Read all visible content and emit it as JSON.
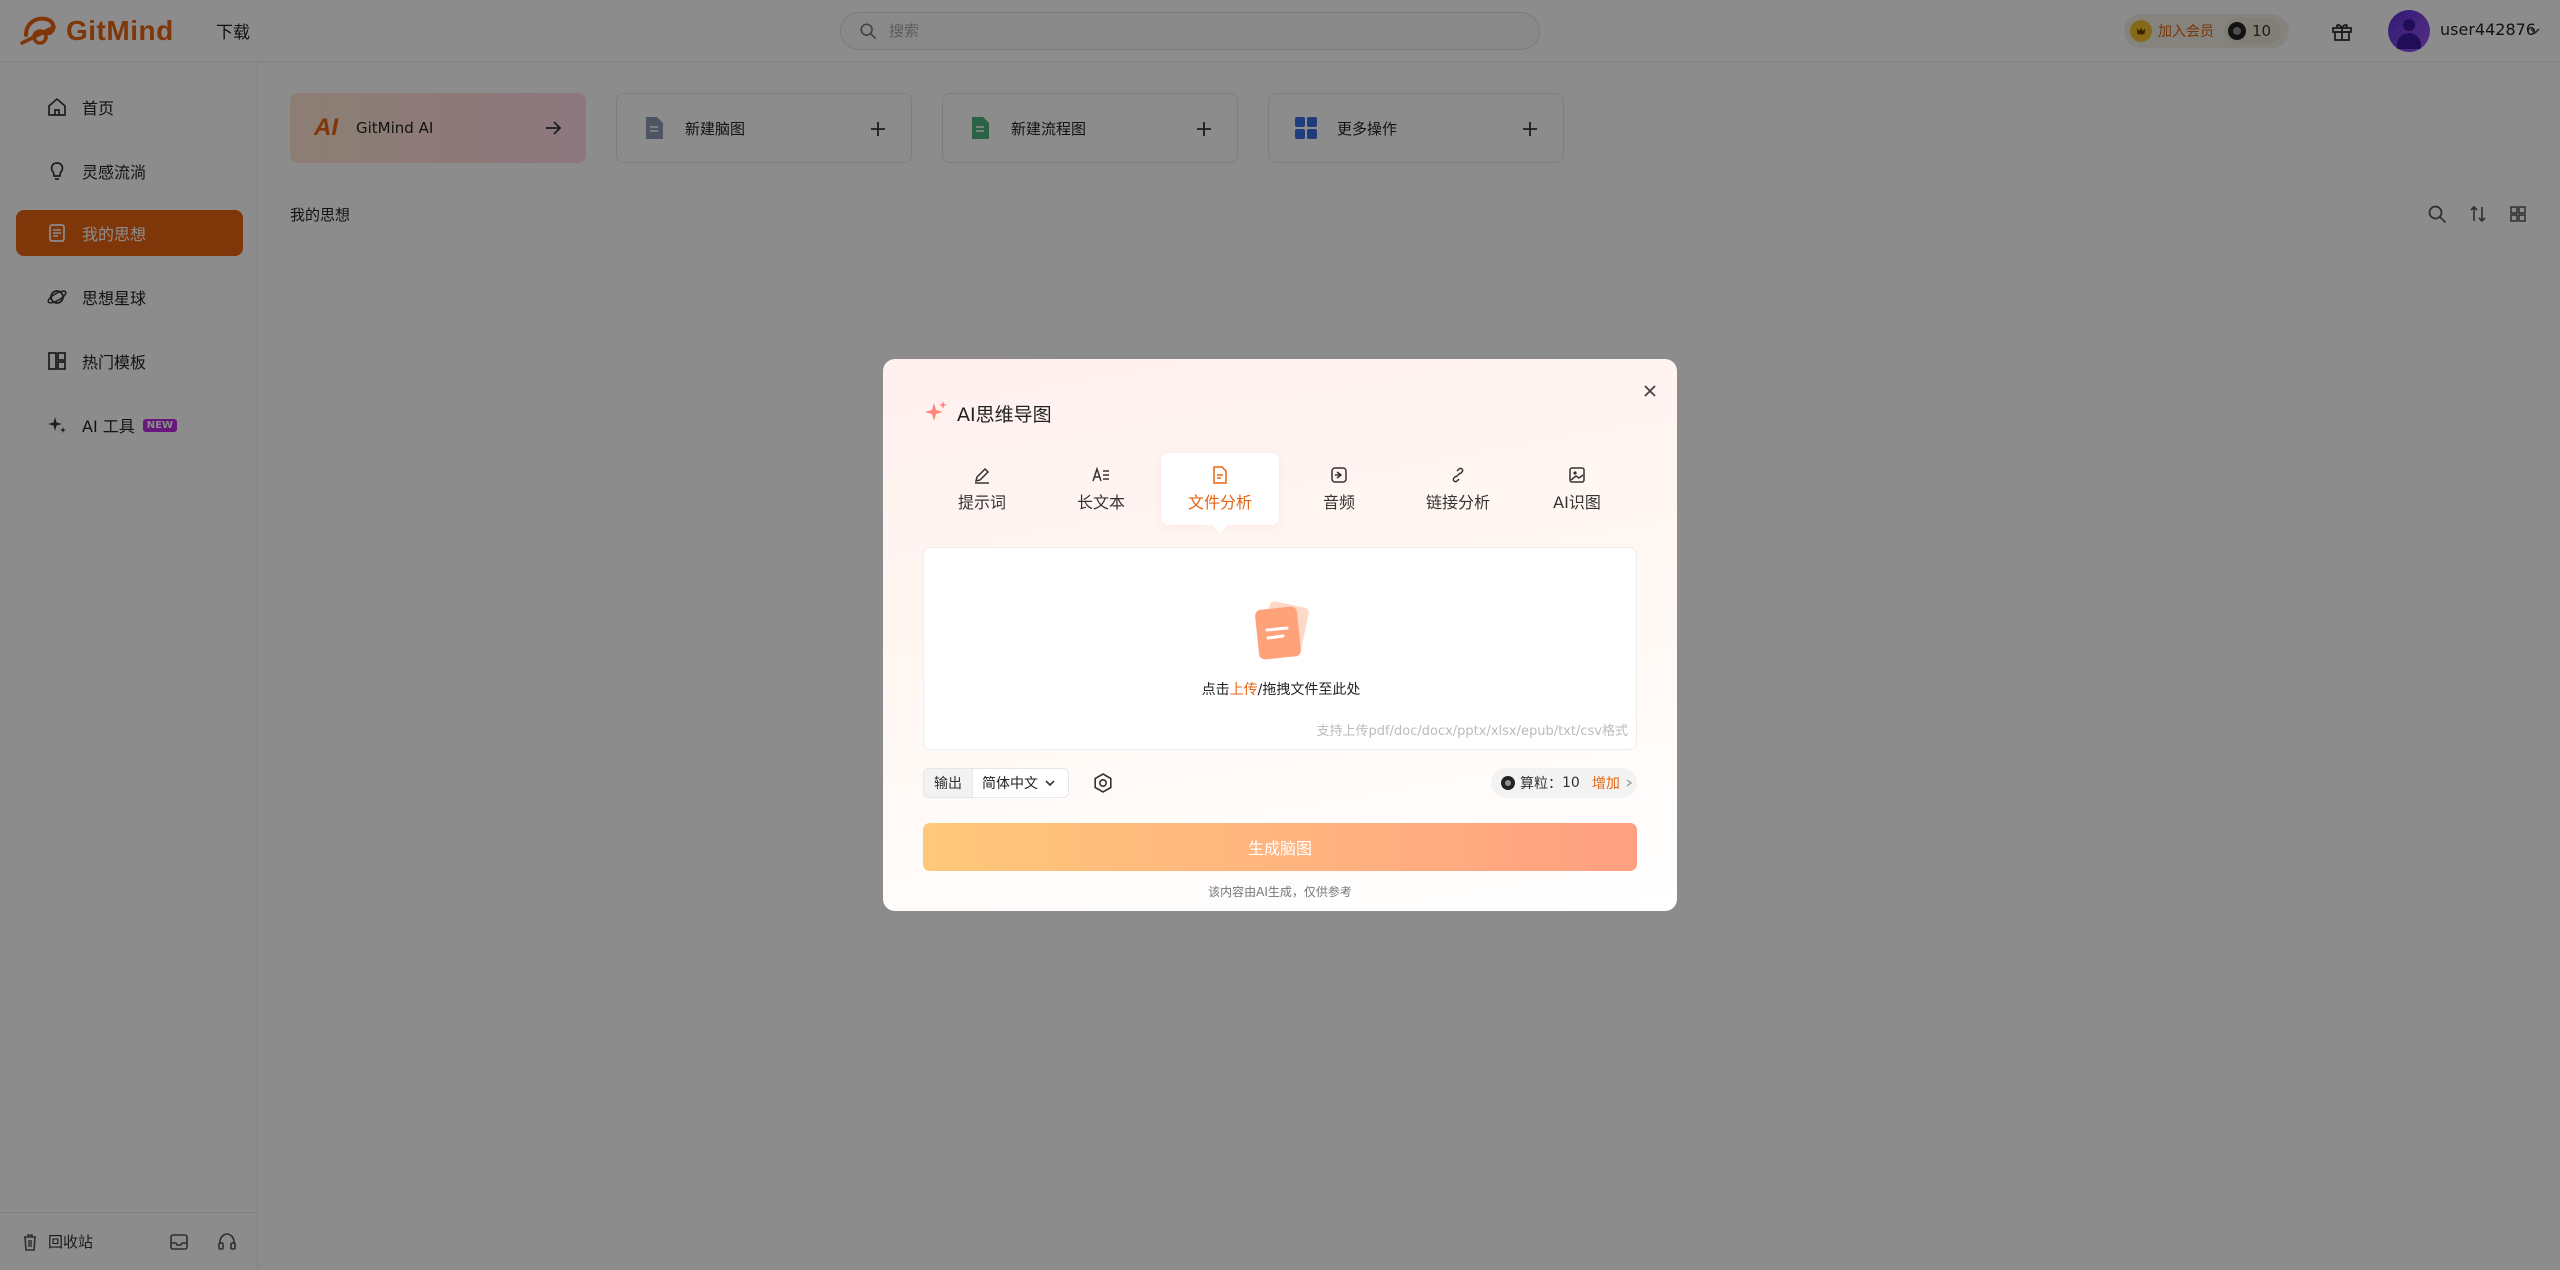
{
  "header": {
    "brand": "GitMind",
    "download": "下载",
    "search_placeholder": "搜索",
    "vip_label": "加入会员",
    "coins": "10",
    "username": "user442876"
  },
  "sidebar": {
    "items": [
      {
        "label": "首页"
      },
      {
        "label": "灵感流淌"
      },
      {
        "label": "我的思想"
      },
      {
        "label": "思想星球"
      },
      {
        "label": "热门模板"
      },
      {
        "label": "AI 工具",
        "badge": "NEW"
      }
    ],
    "active_index": 2,
    "trash": "回收站"
  },
  "main": {
    "cards": [
      {
        "label": "GitMind AI",
        "mark": "AI"
      },
      {
        "label": "新建脑图"
      },
      {
        "label": "新建流程图"
      },
      {
        "label": "更多操作"
      }
    ],
    "section_title": "我的思想"
  },
  "modal": {
    "title": "AI思维导图",
    "tabs": [
      {
        "label": "提示词"
      },
      {
        "label": "长文本"
      },
      {
        "label": "文件分析"
      },
      {
        "label": "音频"
      },
      {
        "label": "链接分析"
      },
      {
        "label": "AI识图"
      }
    ],
    "active_tab": 2,
    "upload": {
      "prefix": "点击",
      "link": "上传",
      "suffix": "/拖拽文件至此处",
      "hint": "支持上传pdf/doc/docx/pptx/xlsx/epub/txt/csv格式"
    },
    "output_label": "输出",
    "language": "简体中文",
    "credits_label": "算粒：",
    "credits_value": "10",
    "add_label": "增加",
    "generate": "生成脑图",
    "disclaimer": "该内容由AI生成，仅供参考"
  },
  "colors": {
    "accent": "#e8630f",
    "overlay": "rgba(0,0,0,0.45)",
    "new_badge": "#c02ae2"
  }
}
